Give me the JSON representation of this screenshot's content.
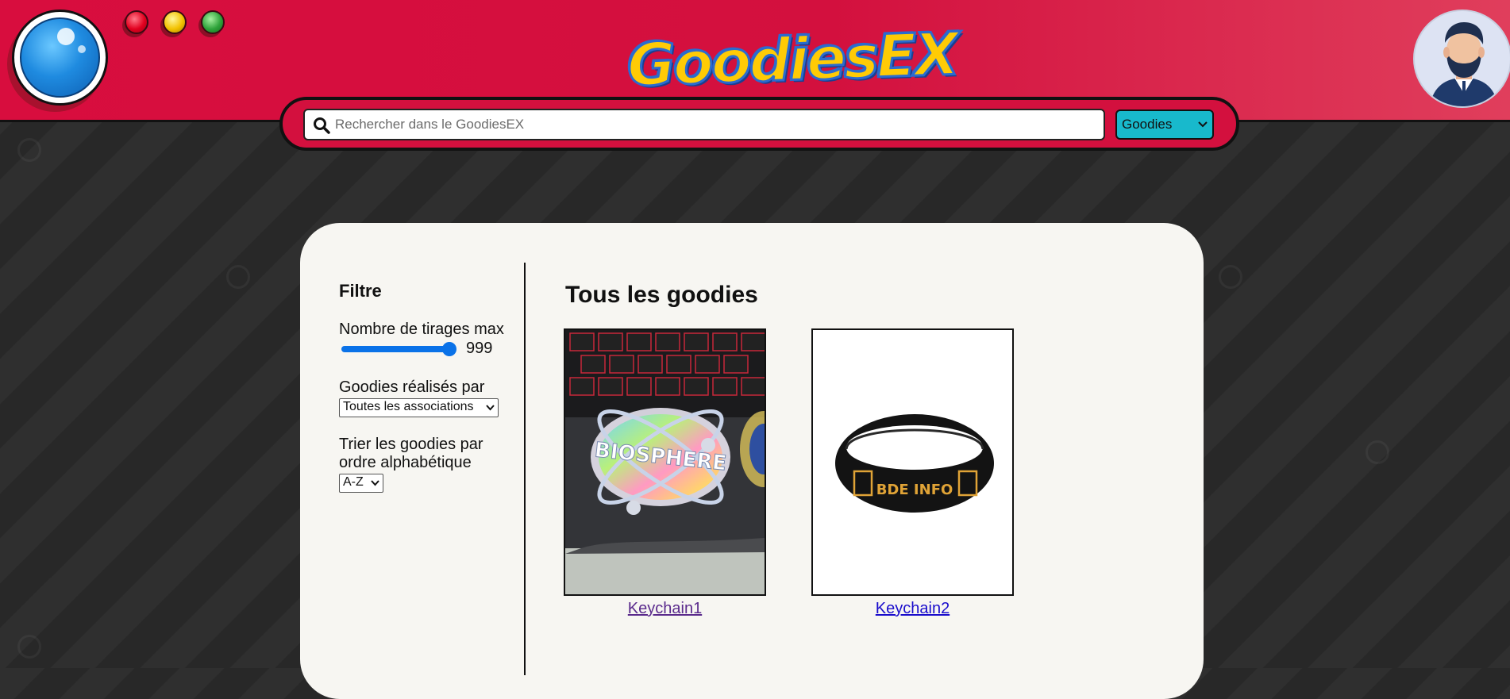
{
  "header": {
    "logo_text": "GoodiesEX",
    "search": {
      "placeholder": "Rechercher dans le GoodiesEX",
      "value": ""
    },
    "type_select": {
      "selected": "Goodies",
      "options": [
        "Goodies"
      ]
    }
  },
  "sidebar": {
    "title": "Filtre",
    "max_draws": {
      "label": "Nombre de tirages max",
      "value": "999"
    },
    "made_by": {
      "label": "Goodies réalisés par",
      "selected": "Toutes les associations"
    },
    "sort": {
      "label_line1": "Trier les goodies par",
      "label_line2": "ordre alphabétique",
      "selected": "A-Z"
    }
  },
  "main": {
    "title": "Tous les goodies",
    "items": [
      {
        "name": "Keychain1",
        "image_text": "BIOSPHERE"
      },
      {
        "name": "Keychain2",
        "image_text": "BDE INFO"
      }
    ]
  },
  "colors": {
    "header_red": "#d3103e",
    "accent_blue": "#0a72e8",
    "select_cyan": "#18b9cc",
    "logo_yellow": "#ffcb05"
  },
  "icons": {
    "search": "search-icon",
    "chevron": "chevron-down-icon",
    "avatar": "user-avatar",
    "lens": "pokedex-lens-icon"
  }
}
